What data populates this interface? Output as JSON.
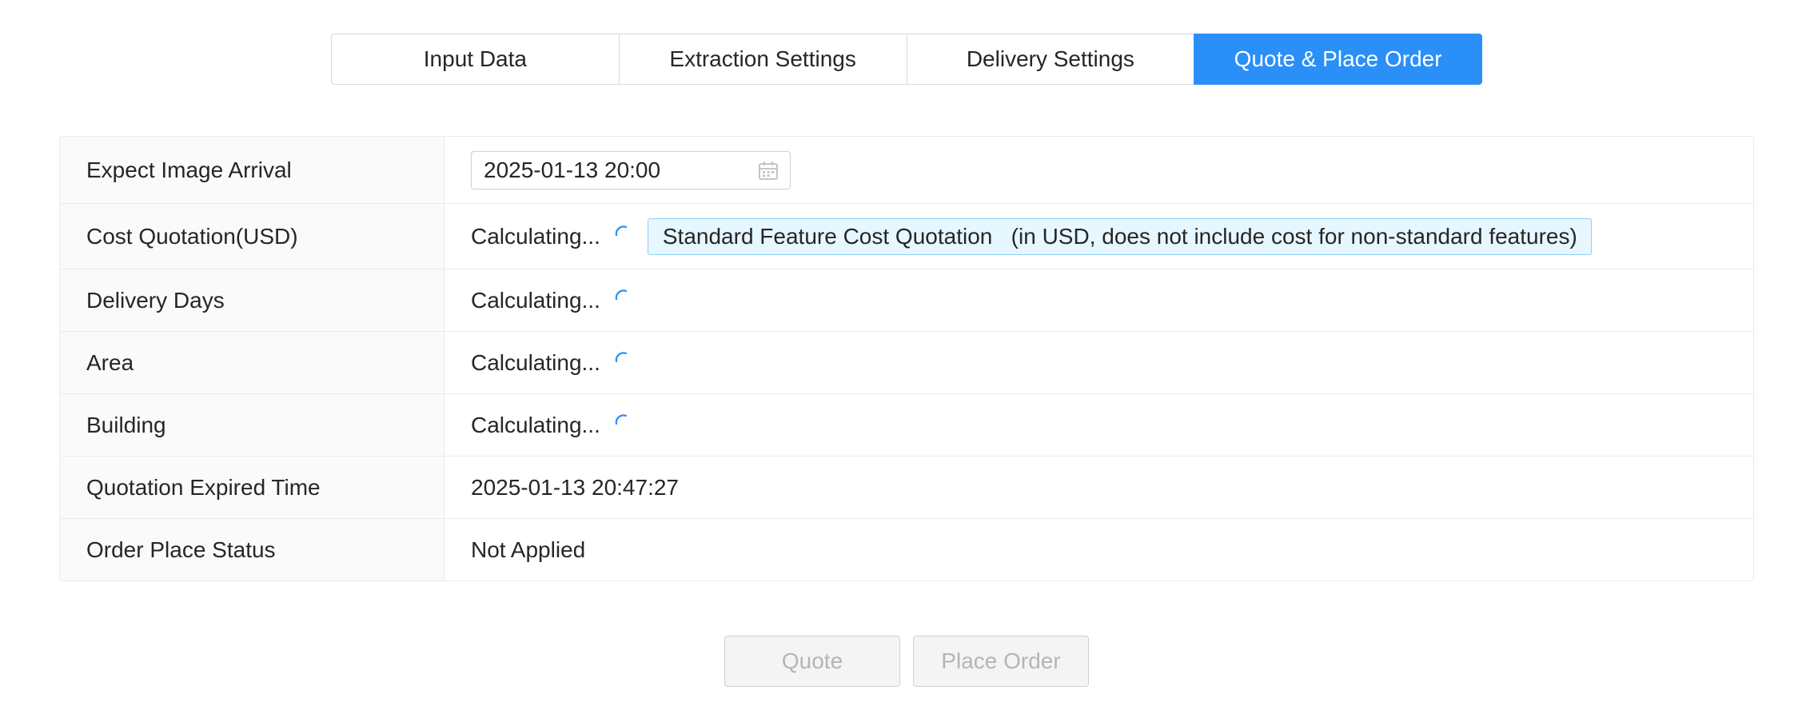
{
  "tabs": [
    {
      "label": "Input Data",
      "active": false
    },
    {
      "label": "Extraction Settings",
      "active": false
    },
    {
      "label": "Delivery Settings",
      "active": false
    },
    {
      "label": "Quote & Place Order",
      "active": true
    }
  ],
  "form": {
    "expect_arrival": {
      "label": "Expect Image Arrival",
      "value": "2025-01-13 20:00",
      "icon": "calendar-icon"
    },
    "cost_quotation": {
      "label": "Cost Quotation(USD)",
      "value": "Calculating...",
      "info": "Standard Feature Cost Quotation   (in USD, does not include cost for non-standard features)"
    },
    "delivery_days": {
      "label": "Delivery Days",
      "value": "Calculating..."
    },
    "area": {
      "label": "Area",
      "value": "Calculating..."
    },
    "building": {
      "label": "Building",
      "value": "Calculating..."
    },
    "quotation_expired": {
      "label": "Quotation Expired Time",
      "value": "2025-01-13 20:47:27"
    },
    "order_status": {
      "label": "Order Place Status",
      "value": "Not Applied"
    }
  },
  "actions": {
    "quote_label": "Quote",
    "place_order_label": "Place Order",
    "disabled": true
  },
  "colors": {
    "accent": "#2a8ff7",
    "info_bg": "#e6f7ff",
    "info_border": "#8fd0f5",
    "disabled_text": "#b5b5b5"
  }
}
